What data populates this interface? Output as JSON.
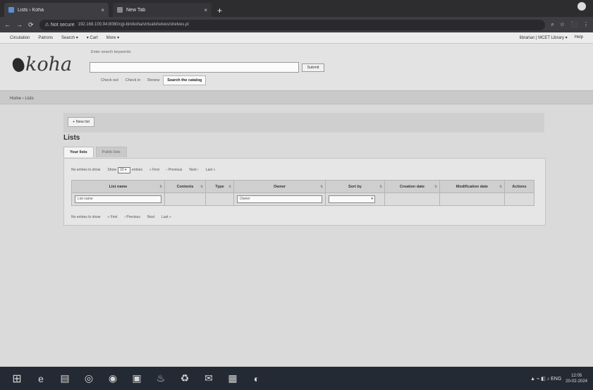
{
  "browser": {
    "tabs": [
      {
        "title": "Lists › Koha",
        "close": "×",
        "active": true
      },
      {
        "title": "New Tab",
        "close": "×",
        "active": false
      }
    ],
    "new_tab": "+",
    "url_warning": "⚠ Not secure",
    "url": "192.168.100.94:8080/cgi-bin/koha/virtualshelves/shelves.pl",
    "nav": {
      "back": "←",
      "forward": "→",
      "reload": "⟳"
    },
    "right_icons": [
      "⌕",
      "☆",
      "⬛",
      "⋮"
    ]
  },
  "koha_nav": {
    "items": [
      "Circulation",
      "Patrons",
      "Search ▾",
      "▾ Cart",
      "More ▾"
    ],
    "right": [
      "librarian | MCET Library ▾",
      "Help"
    ]
  },
  "header": {
    "logo": "koha",
    "hint": "Enter search keywords:",
    "query": "",
    "submit": "Submit",
    "tabs": [
      "Check out",
      "Check in",
      "Renew",
      "Search the catalog"
    ],
    "selected_tab": "Search the catalog"
  },
  "breadcrumb": "Home › Lists",
  "main": {
    "new_list": "+ New list",
    "title": "Lists",
    "tabs": [
      "Your lists",
      "Public lists"
    ],
    "pager_top": {
      "no_entries": "No entries to show",
      "show_label": "Show",
      "show_value": "20",
      "entries_label": "entries",
      "first": "« First",
      "previous": "‹ Previous",
      "next": "Next ›",
      "last": "Last »"
    },
    "table": {
      "columns": [
        "List name",
        "Contents",
        "Type",
        "Owner",
        "Sort by",
        "Creation date",
        "Modification date",
        "Actions"
      ],
      "sort_glyph": "⇅",
      "filters": {
        "list_name": "List name",
        "owner": "Owner"
      }
    },
    "pager_bottom": {
      "no_entries": "No entries to show",
      "first": "« First",
      "previous": "‹ Previous",
      "next": "Next",
      "last": "Last »"
    }
  },
  "taskbar": {
    "icons": [
      "⊞",
      "e",
      "▤",
      "◎",
      "◉",
      "▣",
      "♨",
      "♻",
      "✉",
      "▦",
      "◐"
    ],
    "tray": "▲ ⌁ ◧ ♪ ENG",
    "time": "12:05",
    "date": "20-02-2024"
  }
}
